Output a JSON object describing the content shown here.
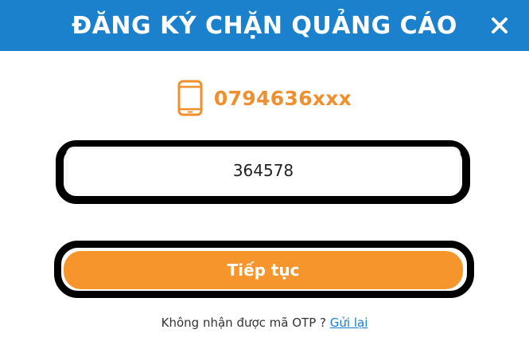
{
  "dialog": {
    "title": "ĐĂNG KÝ CHẶN QUẢNG CÁO",
    "close_icon": "close-icon",
    "close_symbol": "×"
  },
  "phone": {
    "icon": "mobile-phone-icon",
    "number": "0794636xxx"
  },
  "otp": {
    "value": "364578"
  },
  "actions": {
    "continue_label": "Tiếp tục"
  },
  "resend": {
    "prompt": "Không nhận được mã OTP ?",
    "link_label": "Gửi lại"
  },
  "colors": {
    "header": "#1b81cc",
    "accent_orange": "#f5952b",
    "phone_text": "#ef8f2e",
    "link": "#1b7fd4"
  }
}
